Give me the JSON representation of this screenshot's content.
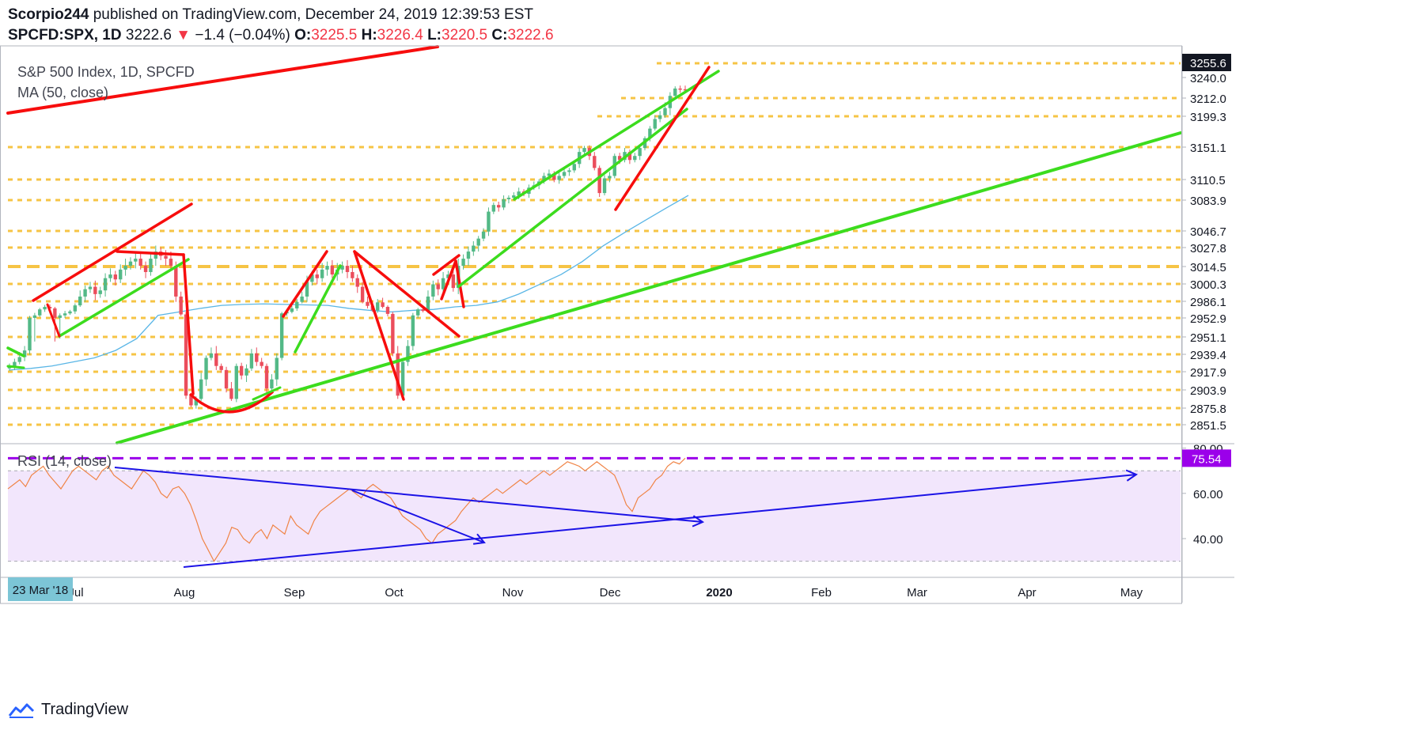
{
  "header": {
    "author": "Scorpio244",
    "published_text": " published on TradingView.com, December 24, 2019 12:39:53 EST",
    "symbol": "SPCFD:SPX, 1D",
    "last_price": " 3222.6",
    "change_arrow": "▼",
    "change_text": " −1.4 (−0.04%)",
    "o_label": " O:",
    "o_value": "3225.5",
    "h_label": " H:",
    "h_value": "3226.4",
    "l_label": " L:",
    "l_value": "3220.5",
    "c_label": " C:",
    "c_value": "3222.6"
  },
  "legend": {
    "title": "S&P 500 Index, 1D, SPCFD",
    "ma": "MA (50, close)",
    "rsi": "RSI (14, close)"
  },
  "footer": {
    "brand": "TradingView"
  },
  "colors": {
    "candle_up": "#53b987",
    "candle_down": "#eb4d5c",
    "support": "#f6c445",
    "red_trend": "#f70d0d",
    "green_trend": "#3cdc1e",
    "ma_line": "#5ab6e6",
    "rsi_line": "#f08446",
    "rsi_band": "#f2e6fc",
    "rsi_level": "#9b00ea",
    "rsi_drawing": "#1b12e6",
    "last_label": "#131722"
  },
  "chart_data": [
    {
      "type": "candlestick",
      "title": "S&P 500 Index, 1D, SPCFD",
      "indicator": "MA (50, close)",
      "y_axis_labels": [
        3255.6,
        3240.0,
        3212.0,
        3199.3,
        3151.1,
        3110.5,
        3083.9,
        3046.7,
        3027.8,
        3014.5,
        3000.3,
        2986.1,
        2952.9,
        2951.1,
        2939.4,
        2917.9,
        2903.9,
        2875.8,
        2851.5
      ],
      "support_resistance_levels": [
        3255.6,
        3212.0,
        3199.3,
        3151.1,
        3110.5,
        3083.9,
        3046.7,
        3027.8,
        3014.5,
        3000.3,
        2986.1,
        2952.9,
        2951.1,
        2939.4,
        2917.9,
        2903.9,
        2875.8,
        2851.5
      ],
      "x_axis_labels": [
        "Jul",
        "Aug",
        "Sep",
        "Oct",
        "Nov",
        "Dec",
        "2020",
        "Feb",
        "Mar",
        "Apr",
        "May"
      ],
      "cursor_date_label": "23 Mar '18",
      "last_close": 3222.6,
      "close_series": [
        2925,
        2930,
        2936,
        2942,
        2953,
        2958,
        2970,
        2975,
        2972,
        2953,
        2958,
        2962,
        2966,
        2978,
        2990,
        2996,
        2998,
        2992,
        2995,
        3005,
        3008,
        3004,
        3012,
        3015,
        3018,
        3020,
        3015,
        3010,
        3020,
        3025,
        3022,
        3020,
        3015,
        2990,
        2960,
        2895,
        2880,
        2890,
        2912,
        2935,
        2940,
        2925,
        2920,
        2905,
        2890,
        2925,
        2915,
        2922,
        2940,
        2930,
        2925,
        2905,
        2912,
        2935,
        2962,
        2965,
        2972,
        2985,
        2990,
        3002,
        3008,
        3005,
        3012,
        3015,
        3008,
        3012,
        3015,
        3010,
        3005,
        2998,
        2985,
        2977,
        2968,
        2984,
        2975,
        2961,
        2940,
        2895,
        2930,
        2945,
        2958,
        2970,
        2967,
        2990,
        3000,
        2996,
        3005,
        3008,
        2997,
        3015,
        3020,
        3025,
        3030,
        3038,
        3046,
        3070,
        3078,
        3075,
        3085,
        3087,
        3090,
        3095,
        3092,
        3100,
        3103,
        3108,
        3115,
        3118,
        3110,
        3115,
        3120,
        3122,
        3130,
        3145,
        3150,
        3140,
        3125,
        3093,
        3112,
        3115,
        3140,
        3135,
        3145,
        3135,
        3140,
        3150,
        3165,
        3180,
        3195,
        3200,
        3205,
        3215,
        3225,
        3224,
        3222.6
      ],
      "ma50_series": [
        2920,
        2922,
        2925,
        2930,
        2935,
        2942,
        2950,
        2958,
        2965,
        2972,
        2978,
        2980,
        2981,
        2980,
        2979,
        2978,
        2972,
        2968,
        2965,
        2968,
        2970,
        2975,
        2978,
        2985,
        2992,
        3000,
        3008,
        3018,
        3030,
        3045,
        3060,
        3075,
        3090
      ]
    },
    {
      "type": "line",
      "title": "RSI (14, close)",
      "y_axis_labels": [
        80.0,
        60.0,
        40.0
      ],
      "ylim": [
        25,
        82
      ],
      "overbought_level": 70,
      "oversold_level": 30,
      "drawn_level": 75.54,
      "last_value": 75.54,
      "values": [
        62,
        64,
        66,
        63,
        68,
        70,
        72,
        68,
        65,
        62,
        66,
        70,
        72,
        70,
        68,
        66,
        70,
        72,
        68,
        66,
        64,
        62,
        66,
        70,
        68,
        65,
        60,
        58,
        62,
        63,
        60,
        55,
        48,
        40,
        35,
        30,
        34,
        38,
        45,
        44,
        40,
        38,
        42,
        44,
        40,
        46,
        44,
        42,
        50,
        46,
        44,
        42,
        48,
        52,
        54,
        56,
        58,
        60,
        62,
        60,
        58,
        62,
        64,
        62,
        60,
        58,
        54,
        50,
        48,
        46,
        44,
        40,
        38,
        42,
        44,
        46,
        48,
        52,
        55,
        58,
        56,
        58,
        60,
        62,
        60,
        62,
        64,
        66,
        64,
        66,
        68,
        70,
        68,
        70,
        72,
        74,
        73,
        72,
        70,
        72,
        74,
        72,
        70,
        68,
        62,
        55,
        52,
        58,
        60,
        62,
        66,
        68,
        72,
        74,
        73,
        75.54
      ]
    }
  ]
}
